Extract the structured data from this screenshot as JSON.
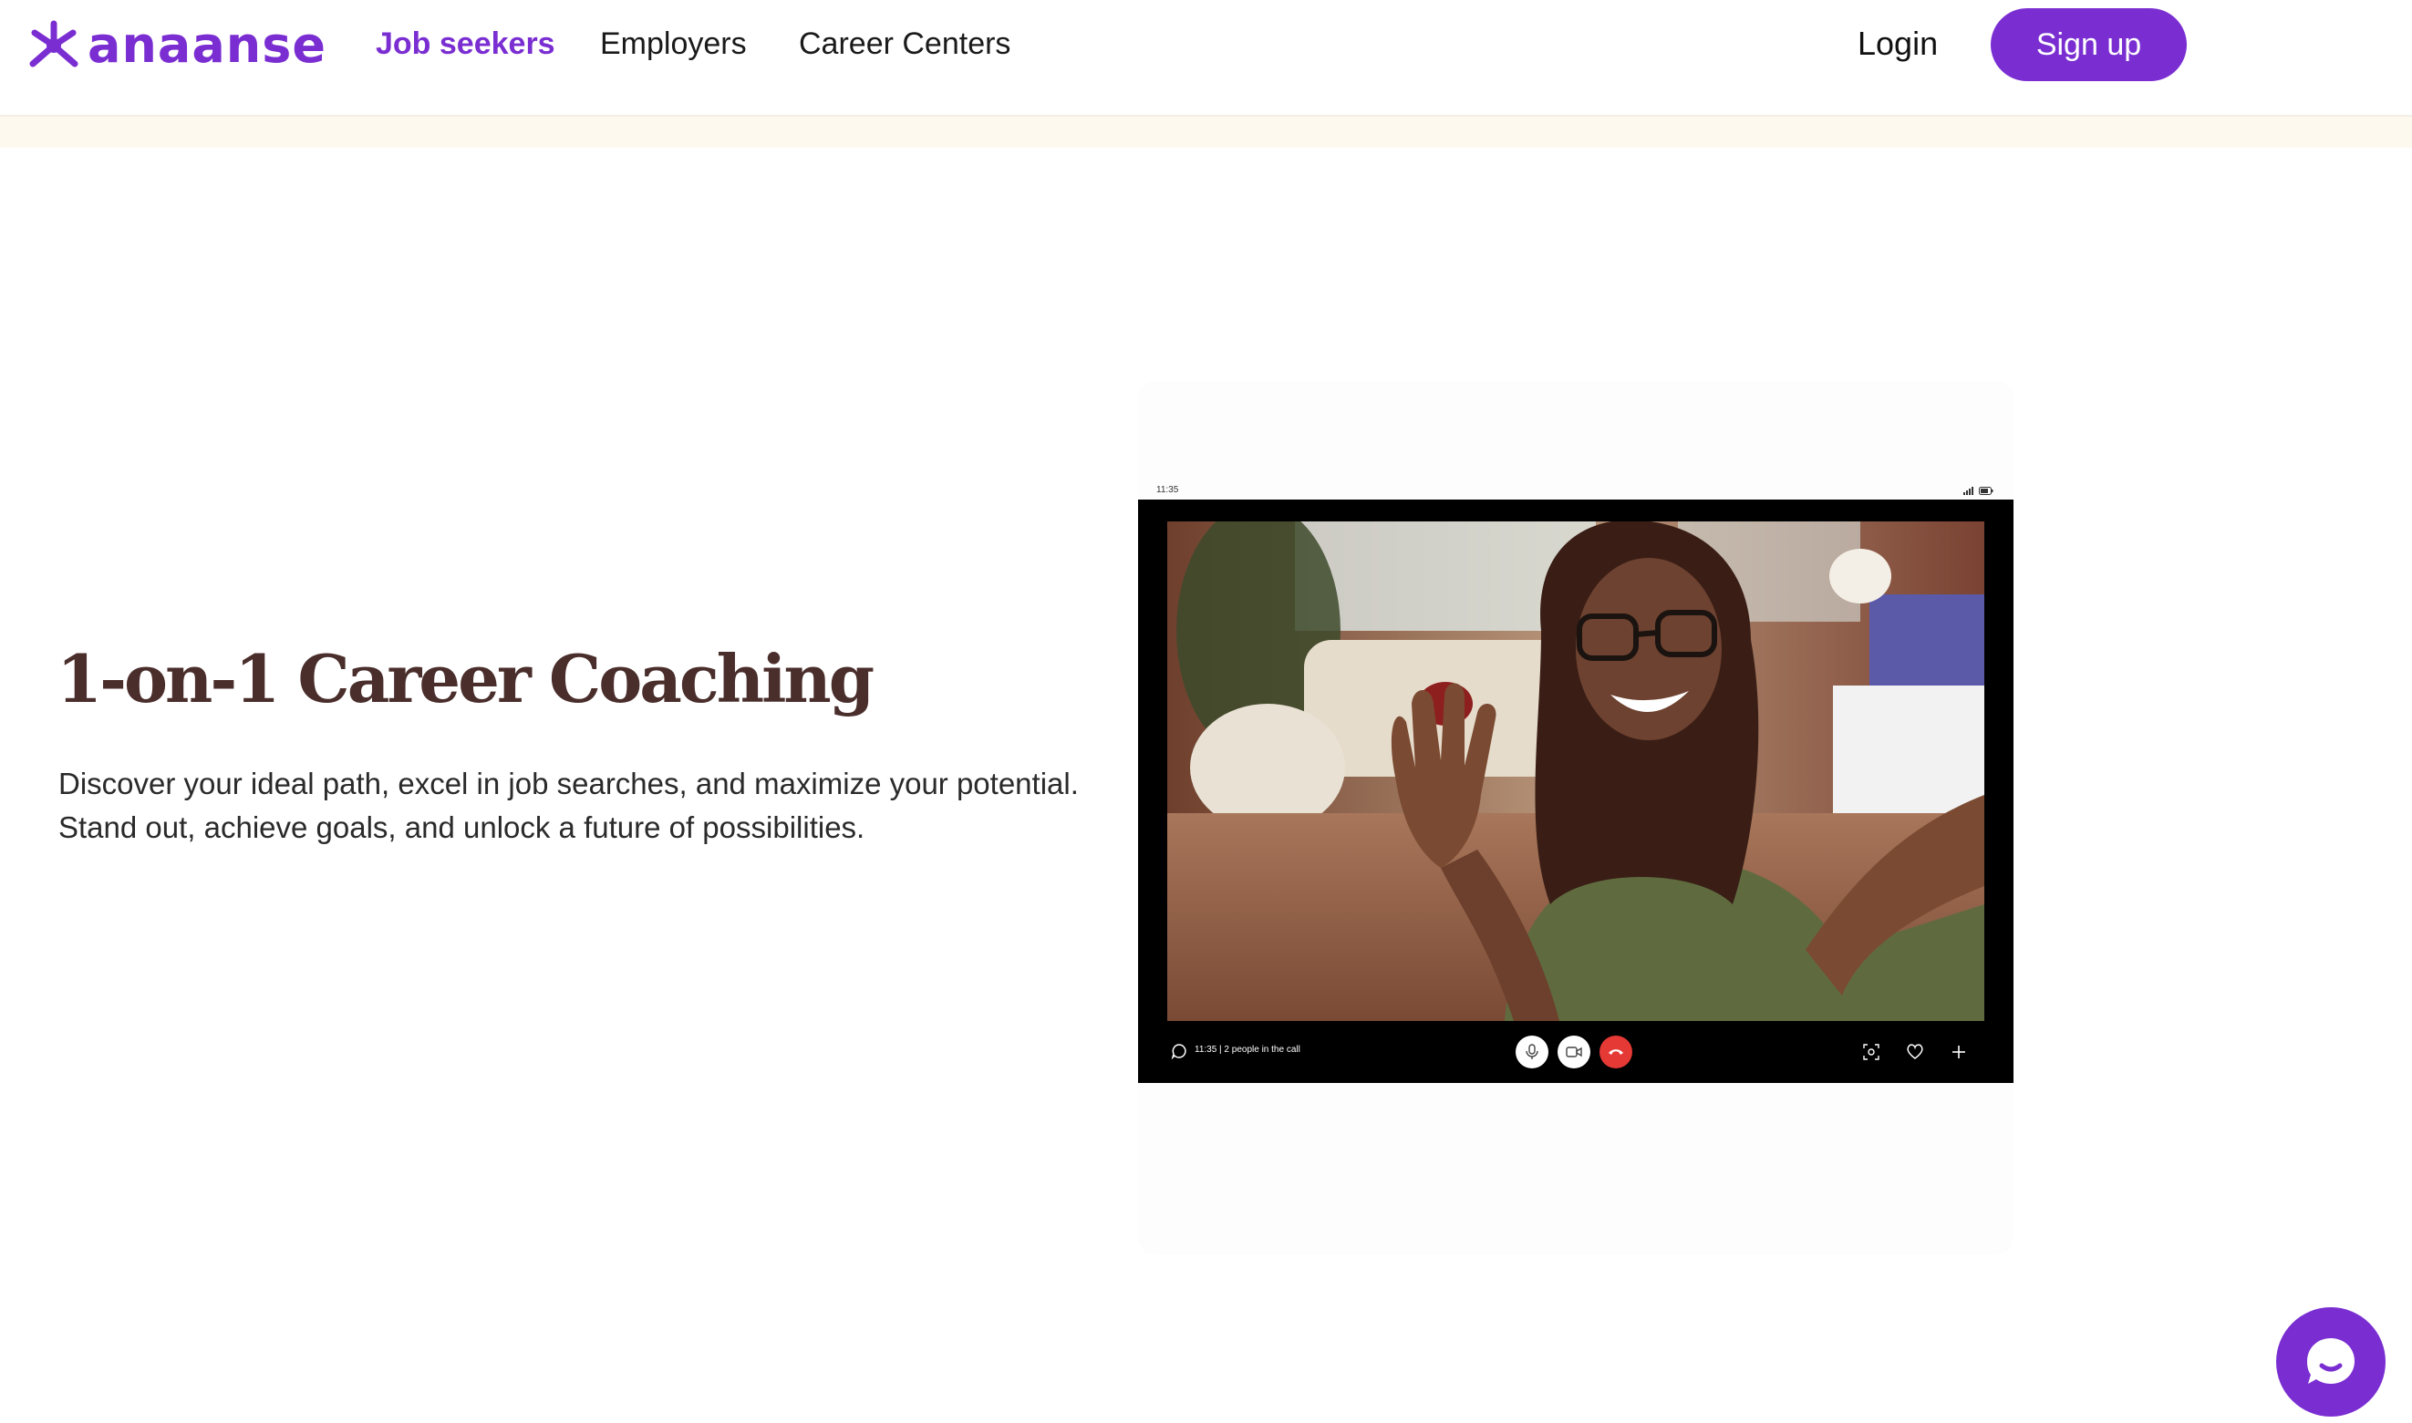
{
  "brand": {
    "name": "anaanse",
    "accent_color": "#7a2ed2",
    "logo_icon": "spider-star-icon"
  },
  "nav": {
    "links": [
      {
        "label": "Job seekers",
        "active": true
      },
      {
        "label": "Employers",
        "active": false
      },
      {
        "label": "Career Centers",
        "active": false
      }
    ],
    "login_label": "Login",
    "signup_label": "Sign up"
  },
  "hero": {
    "title": "1-on-1 Career Coaching",
    "description": "Discover your ideal path, excel in job searches, and maximize your potential. Stand out, achieve goals, and unlock a future of possibilities."
  },
  "video_call": {
    "status_time": "11:35",
    "call_info": "11:35 | 2 people in the call",
    "controls": [
      "microphone-icon",
      "camera-icon",
      "hang-up-icon"
    ],
    "right_controls": [
      "screenshot-icon",
      "heart-icon",
      "plus-icon"
    ]
  },
  "chat_widget": {
    "icon": "chat-bubble-icon"
  }
}
